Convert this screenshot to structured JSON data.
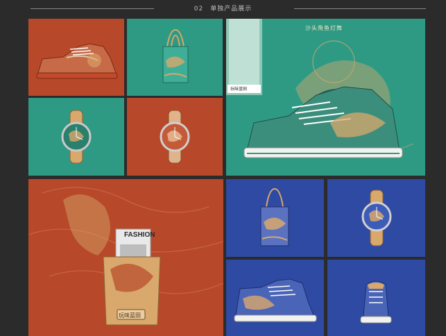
{
  "header": {
    "title": "02　单独产品展示"
  },
  "hero": {
    "tagline": "沙头角鱼灯舞",
    "shoebox_brand": "玩味蓝田"
  },
  "bag": {
    "newspaper_title": "FASHION",
    "bag_brand": "玩味蓝田"
  },
  "colors": {
    "background": "#2b2b2b",
    "rust": "#b7492a",
    "teal": "#2e9a84",
    "blue": "#2f4aa2",
    "sand": "#d8a86c"
  }
}
